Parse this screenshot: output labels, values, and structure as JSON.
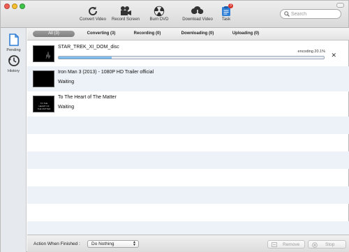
{
  "toolbar": {
    "buttons": [
      {
        "label": "Convert Video",
        "icon": "refresh-icon"
      },
      {
        "label": "Record Screen",
        "icon": "video-camera-icon"
      },
      {
        "label": "Burn DVD",
        "icon": "radiation-disc-icon"
      },
      {
        "label": "Download Video",
        "icon": "cloud-download-icon"
      },
      {
        "label": "Task",
        "icon": "task-clipboard-icon",
        "badge": "3"
      }
    ],
    "search": {
      "placeholder": "Search",
      "value": ""
    }
  },
  "sidebar": {
    "items": [
      {
        "label": "Pending",
        "icon": "document-icon",
        "active": true
      },
      {
        "label": "History",
        "icon": "clock-history-icon",
        "active": false
      }
    ]
  },
  "tabs": [
    {
      "label": "All (3)",
      "active": true
    },
    {
      "label": "Converting (3)",
      "active": false
    },
    {
      "label": "Recording (0)",
      "active": false
    },
    {
      "label": "Downloading (0)",
      "active": false
    },
    {
      "label": "Uploading (0)",
      "active": false
    }
  ],
  "tasks": [
    {
      "title": "STAR_TREK_XI_DOM_disc",
      "encoding_text": "encoding 20.1%",
      "progress": 0.2
    },
    {
      "title": "Iron Man 3 (2013) - 1080P HD Trailer official",
      "status": "Waiting"
    },
    {
      "title": "To The Heart of The Matter",
      "status": "Waiting",
      "thumb_text": "TO THE HEART OF THE MATTER"
    }
  ],
  "footer": {
    "action_label": "Action When Finished :",
    "action_value": "Do Nothing",
    "remove_label": "Remove",
    "stop_label": "Stop"
  },
  "colors": {
    "accent": "#5aa8e2",
    "row_alt": "#edf2f8",
    "badge": "#d9342b",
    "sidebar_active": "#2f7fd6"
  }
}
